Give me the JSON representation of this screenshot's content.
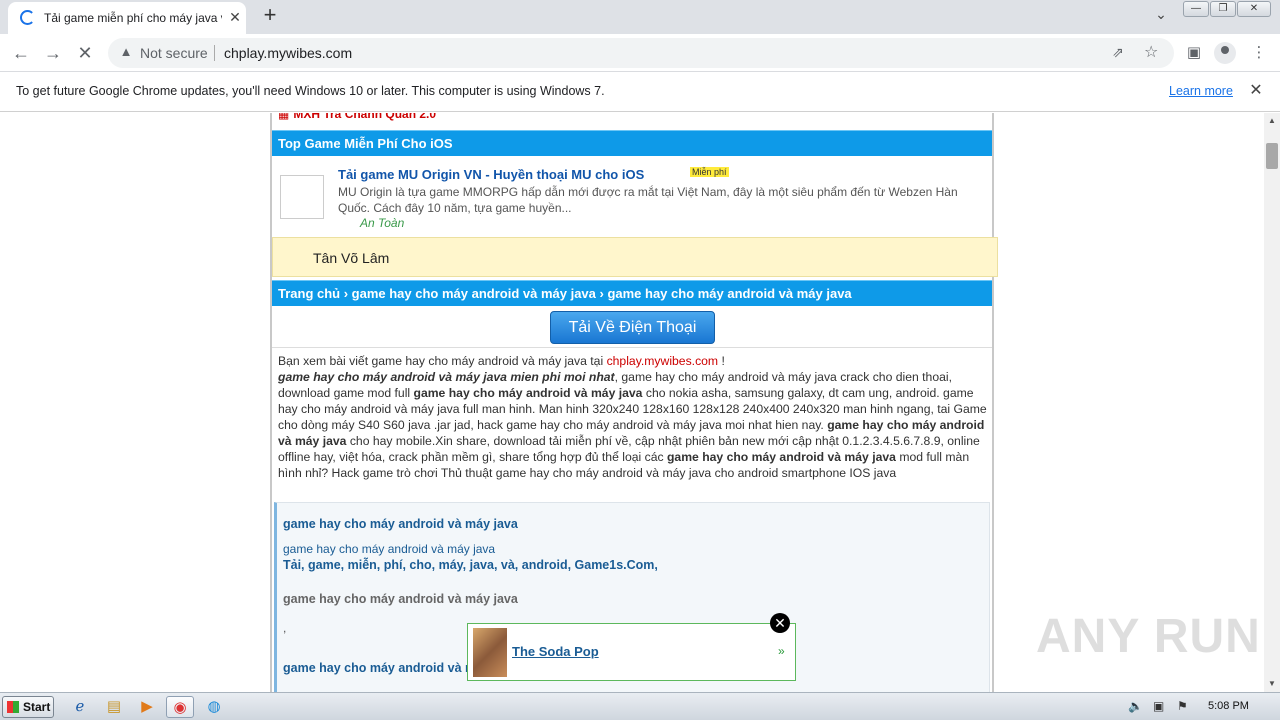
{
  "browser": {
    "tab_title": "Tải game miễn phí cho máy java và a",
    "tab_close": "✕",
    "new_tab": "+",
    "tab_search": "⌄",
    "not_secure": "Not secure",
    "url": "chplay.mywibes.com",
    "win_min": "—",
    "win_max": "❐",
    "win_close": "✕"
  },
  "infobar": {
    "message": "To get future Google Chrome updates, you'll need Windows 10 or later. This computer is using Windows 7.",
    "learn_more": "Learn more",
    "close": "✕"
  },
  "page": {
    "top_link": "MXH Trà Chanh Quán 2.0",
    "ios_header": "Top Game Miễn Phí Cho iOS",
    "game": {
      "title": "Tải game MU Origin VN - Huyền thoại MU cho iOS",
      "badge": "Miễn phí",
      "description": "MU Origin là tựa game MMORPG hấp dẫn mới được ra mắt tại Việt Nam, đây là một siêu phẩm đến từ Webzen Hàn Quốc. Cách đây 10 năm, tựa game huyền...",
      "safe": "An Toàn"
    },
    "yellow_box": "Tân Võ Lâm",
    "breadcrumb": "Trang chủ › game hay cho máy android và máy java › game hay cho máy android và máy java",
    "download_button": "Tải Về Điện Thoại",
    "article": {
      "p1_pre": "Bạn xem bài viết game hay cho máy android và máy java tại ",
      "p1_link": "chplay.mywibes.com",
      "p1_post": " !",
      "b1": "game hay cho máy android và máy java mien phi moi nhat",
      "t1": ", game hay cho máy android và máy java crack cho dien thoai, download game mod full ",
      "b2": "game hay cho máy android và máy java",
      "t2": " cho nokia asha, samsung galaxy, dt cam ung, android. game hay cho máy android và máy java full man hinh. Man hinh 320x240 128x160 128x128 240x400 240x320 man hinh ngang, tai Game cho dòng máy S40 S60 java .jar jad, hack game hay cho máy android và máy java moi nhat hien nay. ",
      "b3": "game hay cho máy android và máy java",
      "t3": " cho hay mobile.Xin share, download tải miễn phí về, cập nhật phiên bản new mới cập nhật 0.1.2.3.4.5.6.7.8.9, online offline hay, việt hóa, crack phần mềm gì, share tổng hợp đủ thể loại các ",
      "b4": "game hay cho máy android và máy java",
      "t4": " mod full màn hình nhỉ? Hack game trò chơi Thủ thuật game hay cho máy android và máy java cho android smartphone IOS java"
    },
    "tagbox": {
      "heading": "game hay cho máy android và máy java",
      "sub": "game hay cho máy android và máy java",
      "tags": "Tải, game, miễn, phí, cho, máy, java, và, android, Game1s.Com,",
      "heading2": "game hay cho máy android và máy java",
      "dot": ",",
      "heading3": "game hay cho máy android và máy java"
    },
    "ad": {
      "name": "The Soda Pop",
      "arrow": "»",
      "close": "✕"
    }
  },
  "watermark": "ANY RUN",
  "taskbar": {
    "start": "Start",
    "clock": "5:08 PM"
  }
}
